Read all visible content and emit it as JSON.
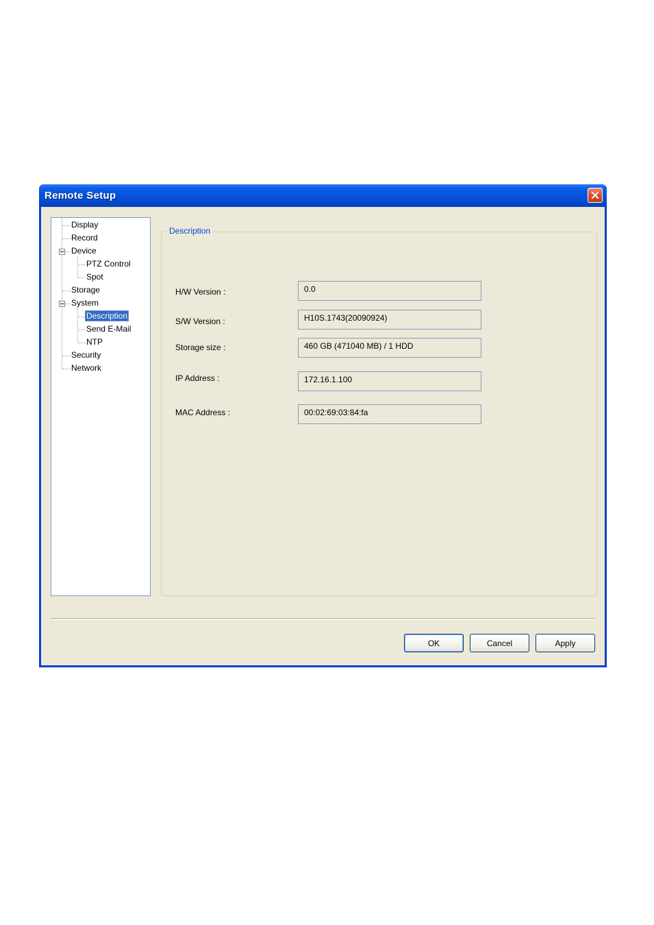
{
  "window": {
    "title": "Remote Setup"
  },
  "tree": {
    "items": [
      {
        "label": "Display"
      },
      {
        "label": "Record"
      },
      {
        "label": "Device"
      },
      {
        "label": "PTZ Control"
      },
      {
        "label": "Spot"
      },
      {
        "label": "Storage"
      },
      {
        "label": "System"
      },
      {
        "label": "Description"
      },
      {
        "label": "Send E-Mail"
      },
      {
        "label": "NTP"
      },
      {
        "label": "Security"
      },
      {
        "label": "Network"
      }
    ],
    "selected": "Description"
  },
  "description": {
    "group_title": "Description",
    "fields": [
      {
        "label": "H/W Version :",
        "value": "0.0"
      },
      {
        "label": "S/W Version :",
        "value": "H10S.1743(20090924)"
      },
      {
        "label": "Storage size :",
        "value": "460 GB (471040 MB) / 1 HDD"
      },
      {
        "label": "IP Address :",
        "value": "172.16.1.100"
      },
      {
        "label": "MAC Address :",
        "value": "00:02:69:03:84:fa"
      }
    ]
  },
  "buttons": {
    "ok": "OK",
    "cancel": "Cancel",
    "apply": "Apply"
  },
  "colors": {
    "titlebar": "#0653dc",
    "client_bg": "#ece9d8",
    "selection": "#316ac5",
    "group_title": "#0046d5"
  }
}
